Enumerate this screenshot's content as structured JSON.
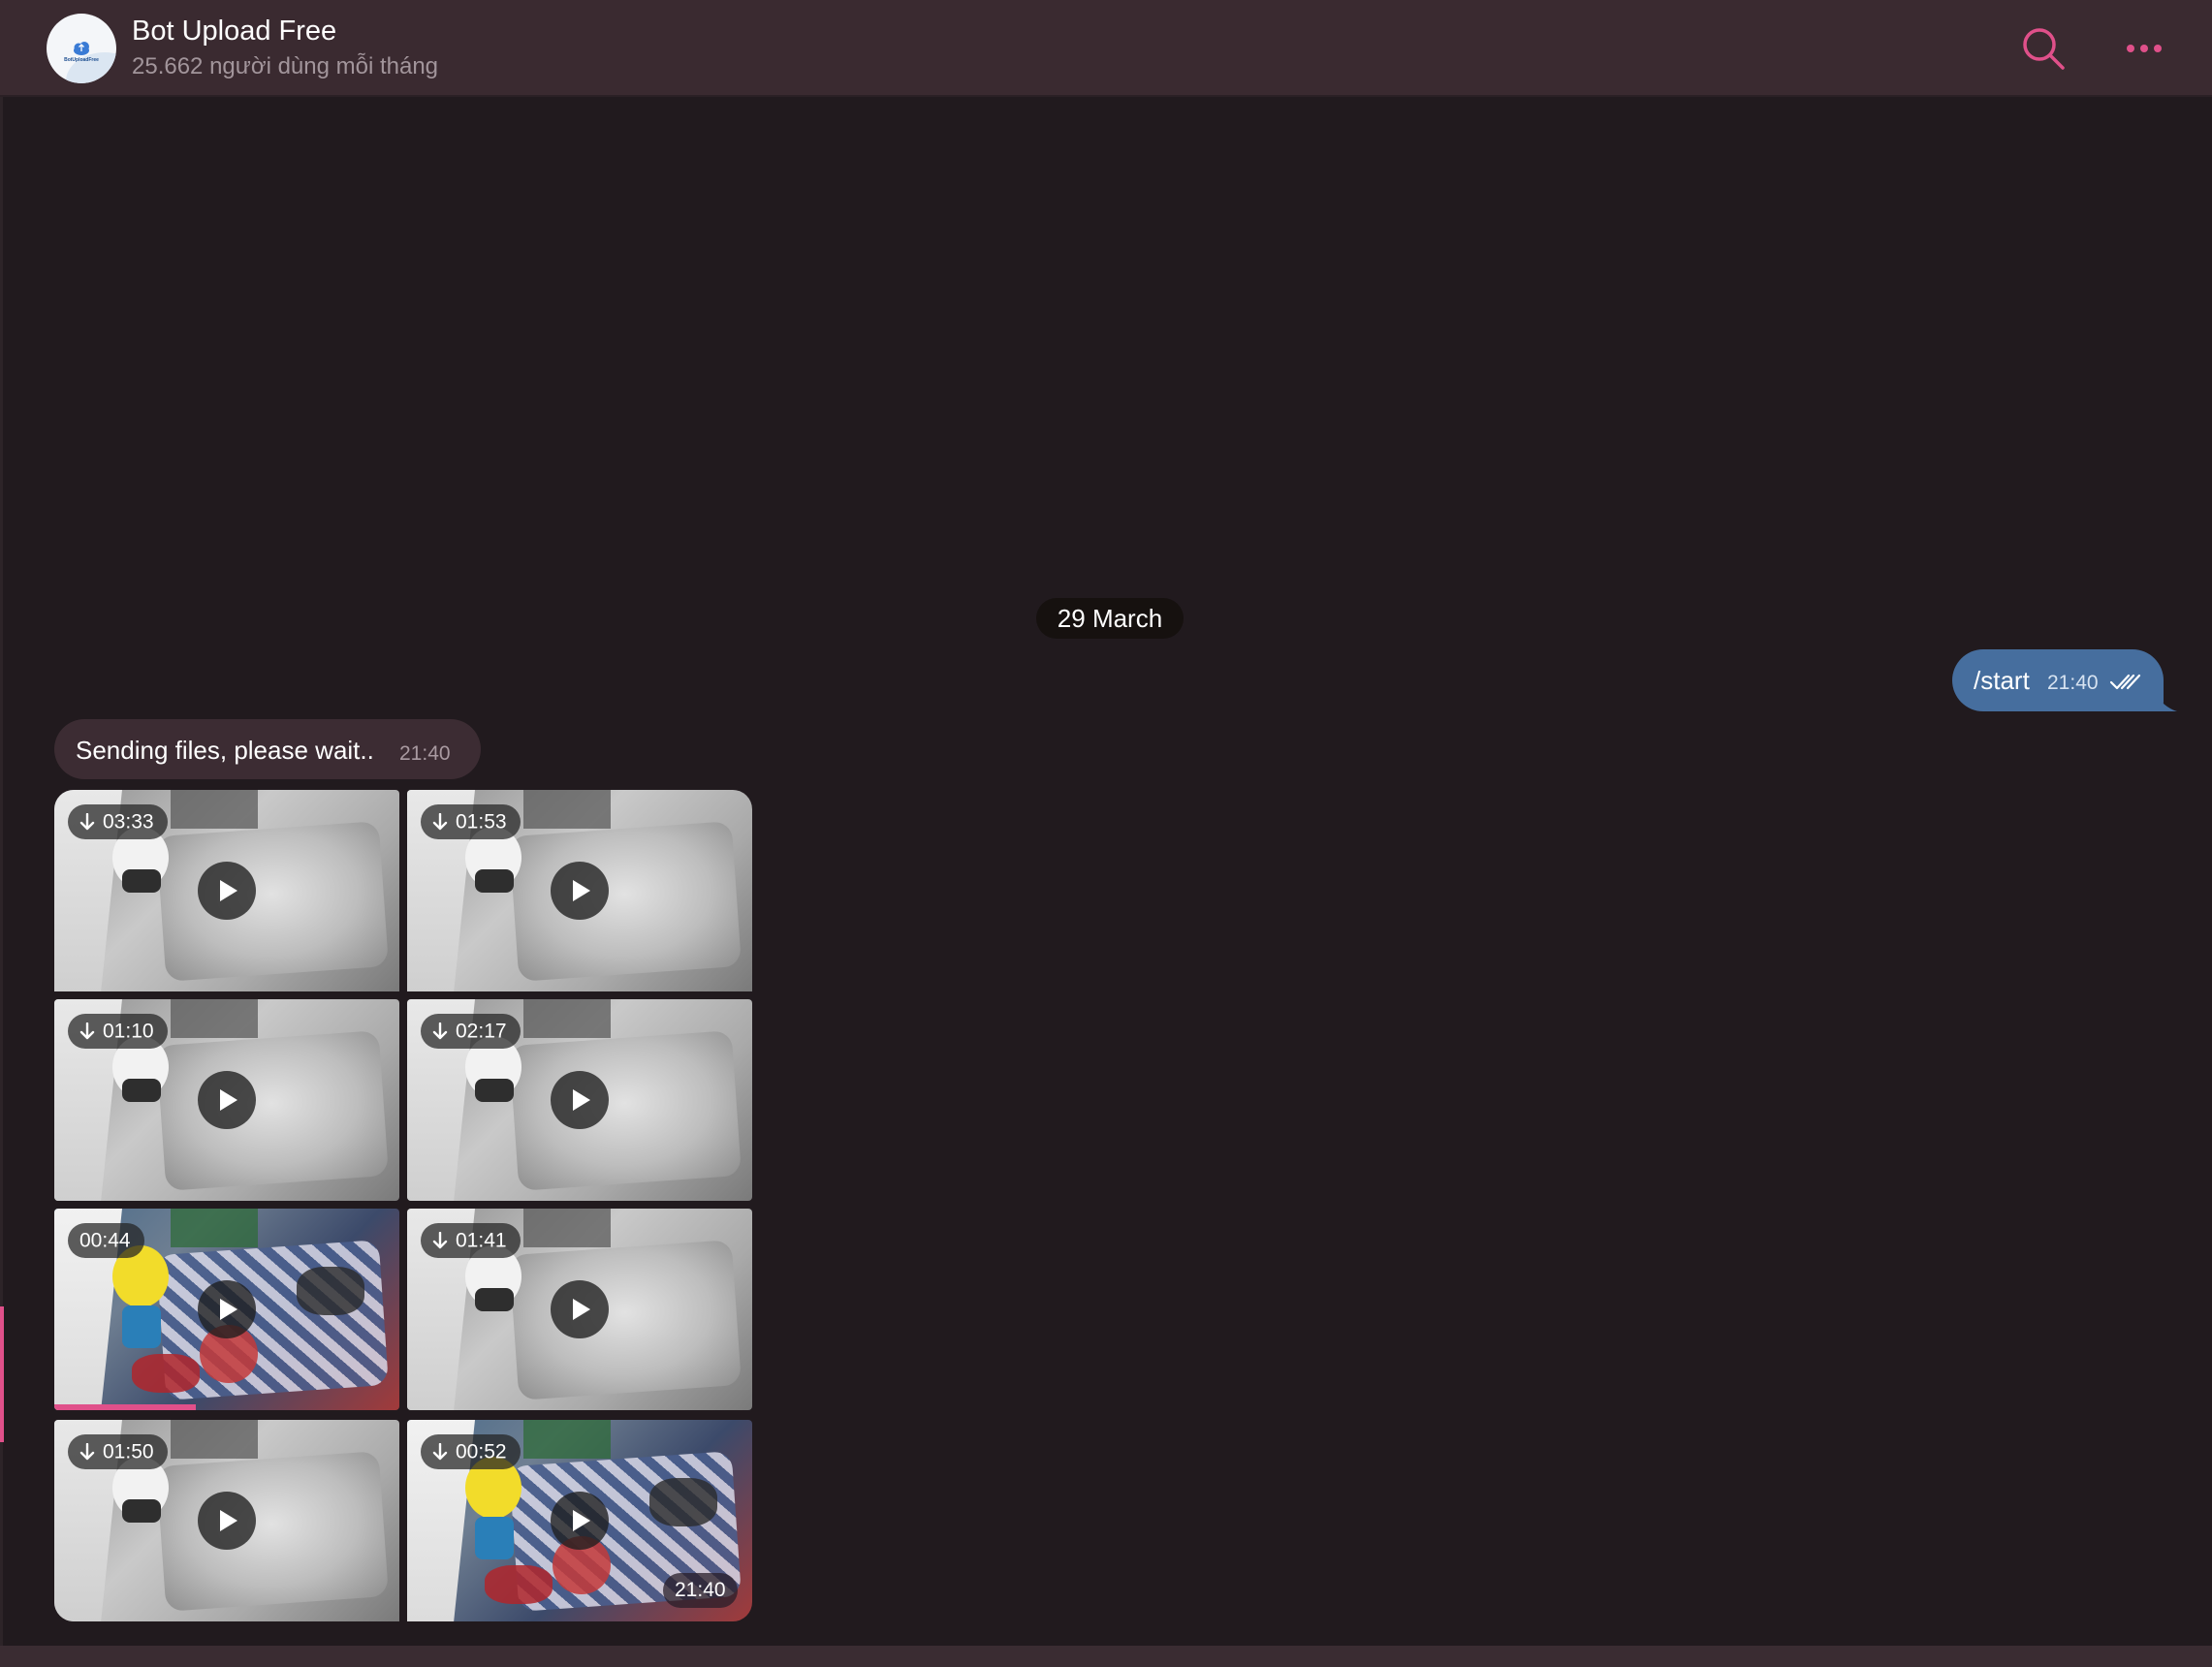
{
  "header": {
    "title": "Bot Upload Free",
    "subtitle": "25.662 người dùng mỗi tháng",
    "avatar_text": "BotUploadFree",
    "search_icon": "search-icon",
    "more_icon": "more-horizontal-icon"
  },
  "messages": {
    "date_separator": "29 March",
    "outgoing": {
      "text": "/start",
      "time": "21:40",
      "status_icon": "double-check-icon"
    },
    "incoming": {
      "text": "Sending files, please wait..",
      "time": "21:40"
    },
    "album": {
      "time": "21:40",
      "videos": [
        {
          "duration": "03:33",
          "downloadable": true,
          "style": "night"
        },
        {
          "duration": "01:53",
          "downloadable": true,
          "style": "night"
        },
        {
          "duration": "01:10",
          "downloadable": true,
          "style": "night"
        },
        {
          "duration": "02:17",
          "downloadable": true,
          "style": "night"
        },
        {
          "duration": "00:44",
          "downloadable": false,
          "style": "color",
          "progress": 0.41
        },
        {
          "duration": "01:41",
          "downloadable": true,
          "style": "night"
        },
        {
          "duration": "01:50",
          "downloadable": true,
          "style": "night"
        },
        {
          "duration": "00:52",
          "downloadable": true,
          "style": "color"
        }
      ]
    }
  },
  "colors": {
    "accent": "#e0508a",
    "outgoing_bubble": "#466e9e",
    "incoming_bubble": "#3c2c33",
    "background": "#211a1e",
    "header": "#3a2a30"
  }
}
